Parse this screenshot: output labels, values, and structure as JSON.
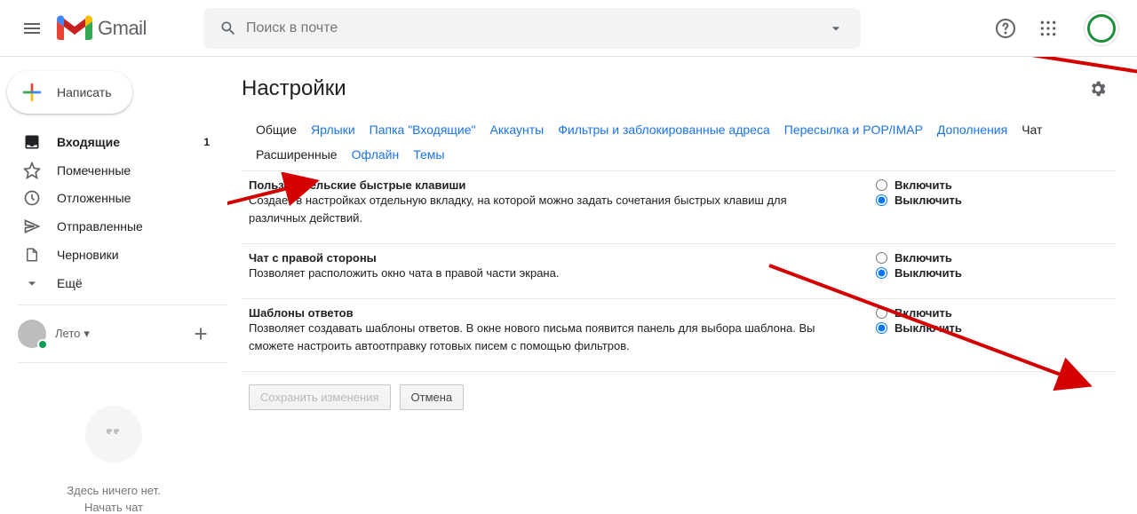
{
  "brand": "Gmail",
  "search": {
    "placeholder": "Поиск в почте"
  },
  "compose": {
    "label": "Написать"
  },
  "sidebar": {
    "items": [
      {
        "label": "Входящие",
        "count": "1"
      },
      {
        "label": "Помеченные"
      },
      {
        "label": "Отложенные"
      },
      {
        "label": "Отправленные"
      },
      {
        "label": "Черновики"
      },
      {
        "label": "Ещё"
      }
    ]
  },
  "hangouts": {
    "user": "Лето",
    "empty": "Здесь ничего нет.",
    "start": "Начать чат"
  },
  "page": {
    "title": "Настройки"
  },
  "tabs": [
    "Общие",
    "Ярлыки",
    "Папка \"Входящие\"",
    "Аккаунты",
    "Фильтры и заблокированные адреса",
    "Пересылка и POP/IMAP",
    "Дополнения",
    "Чат",
    "Расширенные",
    "Офлайн",
    "Темы"
  ],
  "settings": [
    {
      "title": "Пользовательские быстрые клавиши",
      "desc": "Создает в настройках отдельную вкладку, на которой можно задать сочетания быстрых клавиш для различных действий.",
      "enable": "Включить",
      "disable": "Выключить"
    },
    {
      "title": "Чат с правой стороны",
      "desc": "Позволяет расположить окно чата в правой части экрана.",
      "enable": "Включить",
      "disable": "Выключить"
    },
    {
      "title": "Шаблоны ответов",
      "desc": "Позволяет создавать шаблоны ответов. В окне нового письма появится панель для выбора шаблона. Вы сможете настроить автоотправку готовых писем с помощью фильтров.",
      "enable": "Включить",
      "disable": "Выключить"
    }
  ],
  "buttons": {
    "save": "Сохранить изменения",
    "cancel": "Отмена"
  }
}
